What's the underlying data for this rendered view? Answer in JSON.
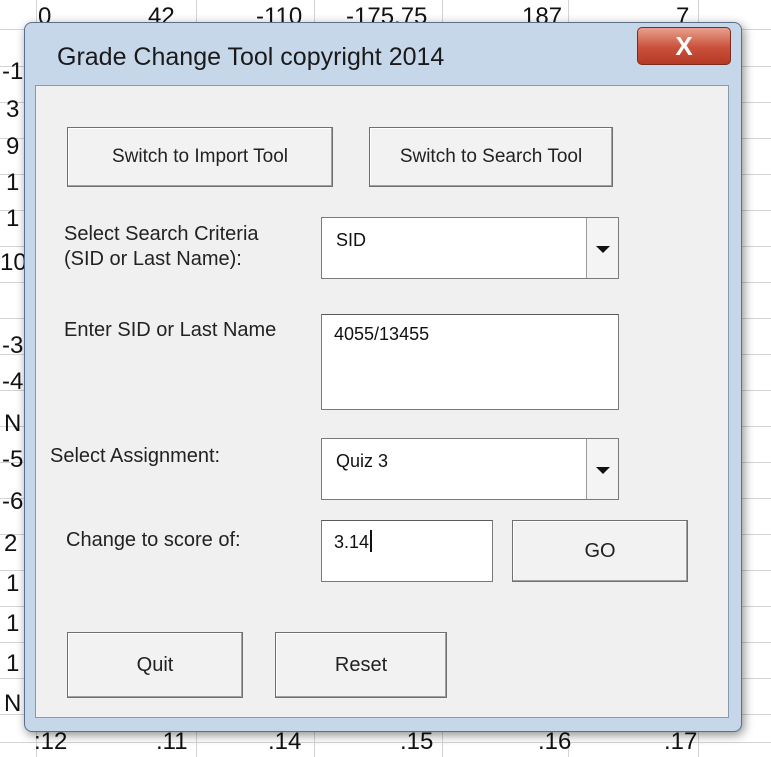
{
  "window": {
    "title": "Grade Change Tool copyright 2014",
    "close_glyph": "X"
  },
  "spreadsheet": {
    "top_row": [
      "0",
      "42",
      "-110",
      "-175.75",
      "187",
      "7"
    ],
    "bottom_row": [
      ":12",
      ".11",
      ".14",
      ".15",
      ".16",
      ".17"
    ],
    "left_column": [
      "-1",
      "3",
      "9",
      "1",
      "1",
      "10",
      "-3",
      "-4",
      "N",
      "-5",
      "-6",
      "2",
      "1",
      "1",
      "1",
      "N"
    ]
  },
  "toolbar": {
    "import_button": "Switch to Import Tool",
    "search_button": "Switch to Search Tool"
  },
  "criteria": {
    "label": "Select Search Criteria\n(SID or Last Name):",
    "value": "SID"
  },
  "sid": {
    "label": "Enter SID or Last Name",
    "value": "4055/13455"
  },
  "assignment": {
    "label": "Select Assignment:",
    "value": "Quiz 3"
  },
  "score": {
    "label": "Change to score of:",
    "value": "3.14"
  },
  "actions": {
    "go": "GO",
    "quit": "Quit",
    "reset": "Reset"
  },
  "colors": {
    "window_frame": "#c7d7ea",
    "client": "#f0f0f0",
    "close_button": "#c9503a"
  }
}
